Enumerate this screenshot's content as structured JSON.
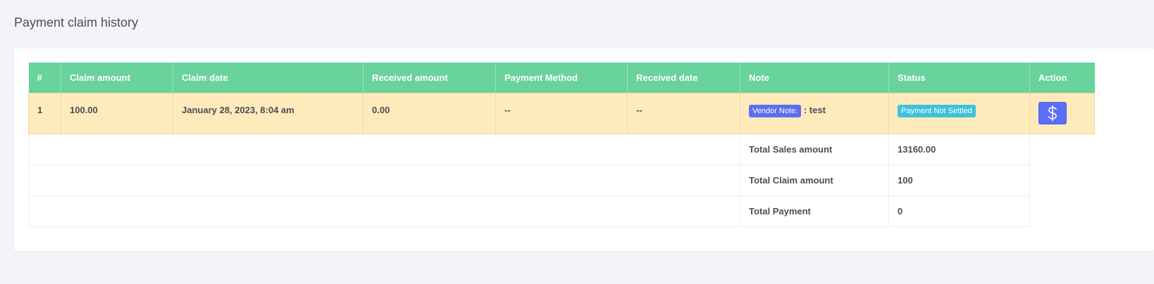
{
  "page": {
    "title": "Payment claim history"
  },
  "table": {
    "headers": [
      "#",
      "Claim amount",
      "Claim date",
      "Received amount",
      "Payment Method",
      "Received date",
      "Note",
      "Status",
      "Action"
    ],
    "rows": [
      {
        "index": "1",
        "claim_amount": "100.00",
        "claim_date": "January 28, 2023, 8:04 am",
        "received_amount": "0.00",
        "payment_method": "--",
        "received_date": "--",
        "note_badge": "Vendor Note:",
        "note_text": ": test",
        "status": "Payment Not Settled",
        "action_icon": "dollar-icon"
      }
    ],
    "totals": [
      {
        "label": "Total Sales amount",
        "value": "13160.00"
      },
      {
        "label": "Total Claim amount",
        "value": "100"
      },
      {
        "label": "Total Payment",
        "value": "0"
      }
    ]
  },
  "colors": {
    "header_bg": "#68d39b",
    "row_highlight": "#ffeabb",
    "vendor_badge": "#5b6ef0",
    "status_badge": "#3fc1dd",
    "action_button": "#5a6ef6"
  }
}
